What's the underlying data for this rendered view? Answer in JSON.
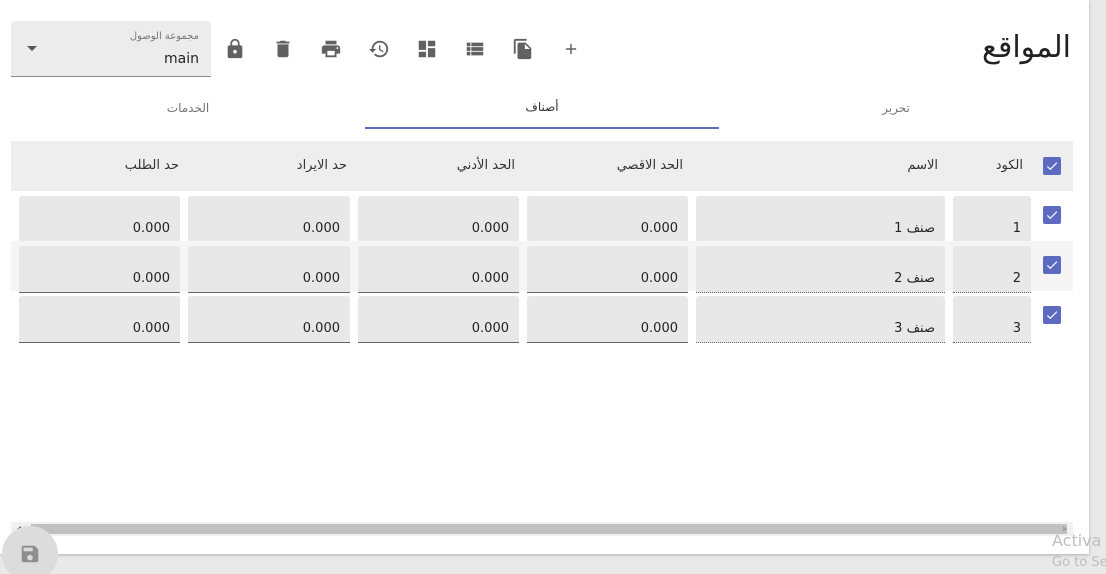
{
  "page": {
    "title": "المواقع"
  },
  "toolbar": {
    "icons": [
      "add-icon",
      "copy-icon",
      "list-icon",
      "dashboard-icon",
      "history-icon",
      "print-icon",
      "delete-icon",
      "lock-icon"
    ]
  },
  "access_group": {
    "label": "مجموعة الوصول",
    "value": "main"
  },
  "tabs": [
    {
      "label": "تحرير",
      "active": false
    },
    {
      "label": "أصناف",
      "active": true
    },
    {
      "label": "الخدمات",
      "active": false
    }
  ],
  "table": {
    "headers": {
      "code": "الكود",
      "name": "الاسم",
      "max": "الحد الاقصي",
      "min": "الحد الأدني",
      "income": "حد الايراد",
      "order": "حد الطلب"
    },
    "rows": [
      {
        "code": "1",
        "name": "صنف 1",
        "max": "0.000",
        "min": "0.000",
        "income": "0.000",
        "order": "0.000"
      },
      {
        "code": "2",
        "name": "صنف 2",
        "max": "0.000",
        "min": "0.000",
        "income": "0.000",
        "order": "0.000"
      },
      {
        "code": "3",
        "name": "صنف 3",
        "max": "0.000",
        "min": "0.000",
        "income": "0.000",
        "order": "0.000"
      }
    ]
  },
  "watermark": {
    "line1": "Activa",
    "line2": "Go to Se"
  },
  "colors": {
    "accent": "#5c6bc0",
    "icon": "#616161"
  }
}
